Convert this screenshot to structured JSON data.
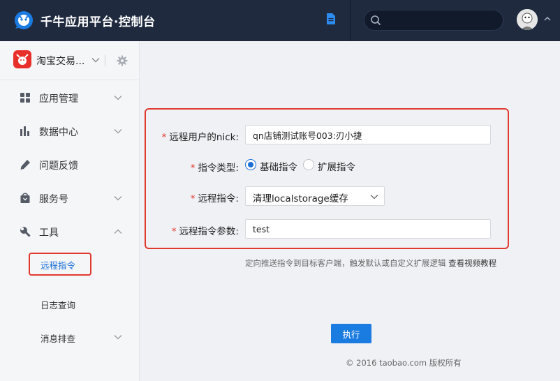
{
  "header": {
    "title": "千牛应用平台·控制台",
    "search_placeholder": "",
    "icons": [
      "qianniu-logo-icon",
      "document-icon",
      "search-icon",
      "chevron-up-icon"
    ]
  },
  "sidebar": {
    "shop_name": "淘宝交易...",
    "items": [
      {
        "label": "应用管理",
        "icon": "grid-icon"
      },
      {
        "label": "数据中心",
        "icon": "bar-chart-icon"
      },
      {
        "label": "问题反馈",
        "icon": "pencil-icon"
      },
      {
        "label": "服务号",
        "icon": "bag-icon"
      },
      {
        "label": "工具",
        "icon": "wrench-icon"
      }
    ],
    "sub_items": [
      {
        "label": "远程指令",
        "active": true
      },
      {
        "label": "日志查询"
      },
      {
        "label": "消息排查"
      }
    ]
  },
  "form": {
    "required_mark": "*",
    "nick_label": "远程用户的nick:",
    "nick_value": "qn店铺测试账号003:刃小捷",
    "type_label": "指令类型:",
    "type_options": [
      "基础指令",
      "扩展指令"
    ],
    "type_selected": "基础指令",
    "command_label": "远程指令:",
    "command_value": "清理localstorage缓存",
    "params_label": "远程指令参数:",
    "params_value": "test",
    "help_text": "定向推送指令到目标客户端，触发默认或自定义扩展逻辑",
    "help_link": "查看视频教程",
    "execute_label": "执行"
  },
  "footer": {
    "copyright": "© 2016 taobao.com 版权所有"
  },
  "colors": {
    "header_bg": "#1f2a3f",
    "accent": "#1a7be0",
    "highlight": "#e03a2f"
  }
}
